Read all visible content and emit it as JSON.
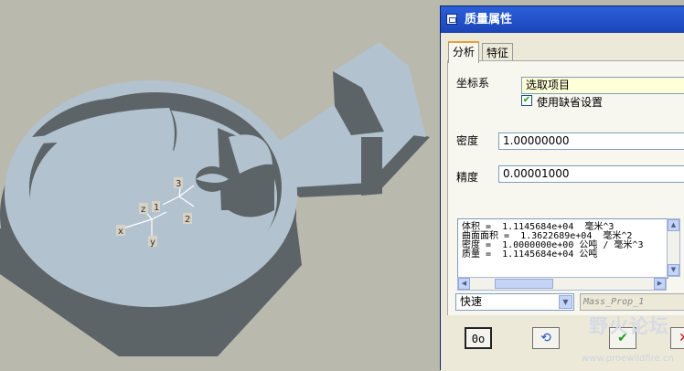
{
  "dialog": {
    "title": "质量属性",
    "tabs": [
      {
        "label": "分析",
        "active": true
      },
      {
        "label": "特征",
        "active": false
      }
    ],
    "coord_system": {
      "label": "坐标系",
      "select_value": "选取项目",
      "use_default_label": "使用缺省设置",
      "use_default_checked": true
    },
    "density": {
      "label": "密度",
      "value": "1.00000000"
    },
    "precision": {
      "label": "精度",
      "value": "0.00001000"
    },
    "results": [
      "体积 =  1.1145684e+04  毫米^3",
      "曲面面积 =  1.3622689e+04  毫米^2",
      "密度 =  1.0000000e+00 公吨 / 毫米^3",
      "质量 =  1.1145684e+04 公吨"
    ],
    "mode_select": "快速",
    "name_field_placeholder": "Mass_Prop_1",
    "buttons": {
      "preview": "0o",
      "recalculate": "⟲",
      "ok": "✔",
      "cancel": "✕"
    }
  },
  "viewport": {
    "axis_labels": [
      "x",
      "y",
      "z",
      "1",
      "3",
      "2"
    ]
  },
  "watermark": {
    "text": "野火论坛",
    "url": "www.proewildfire.cn"
  },
  "colors": {
    "background": "#b9b9ae",
    "part_top": "#b3c2cf",
    "part_side": "#5d6467",
    "title_bar": "#1e4ec2"
  }
}
